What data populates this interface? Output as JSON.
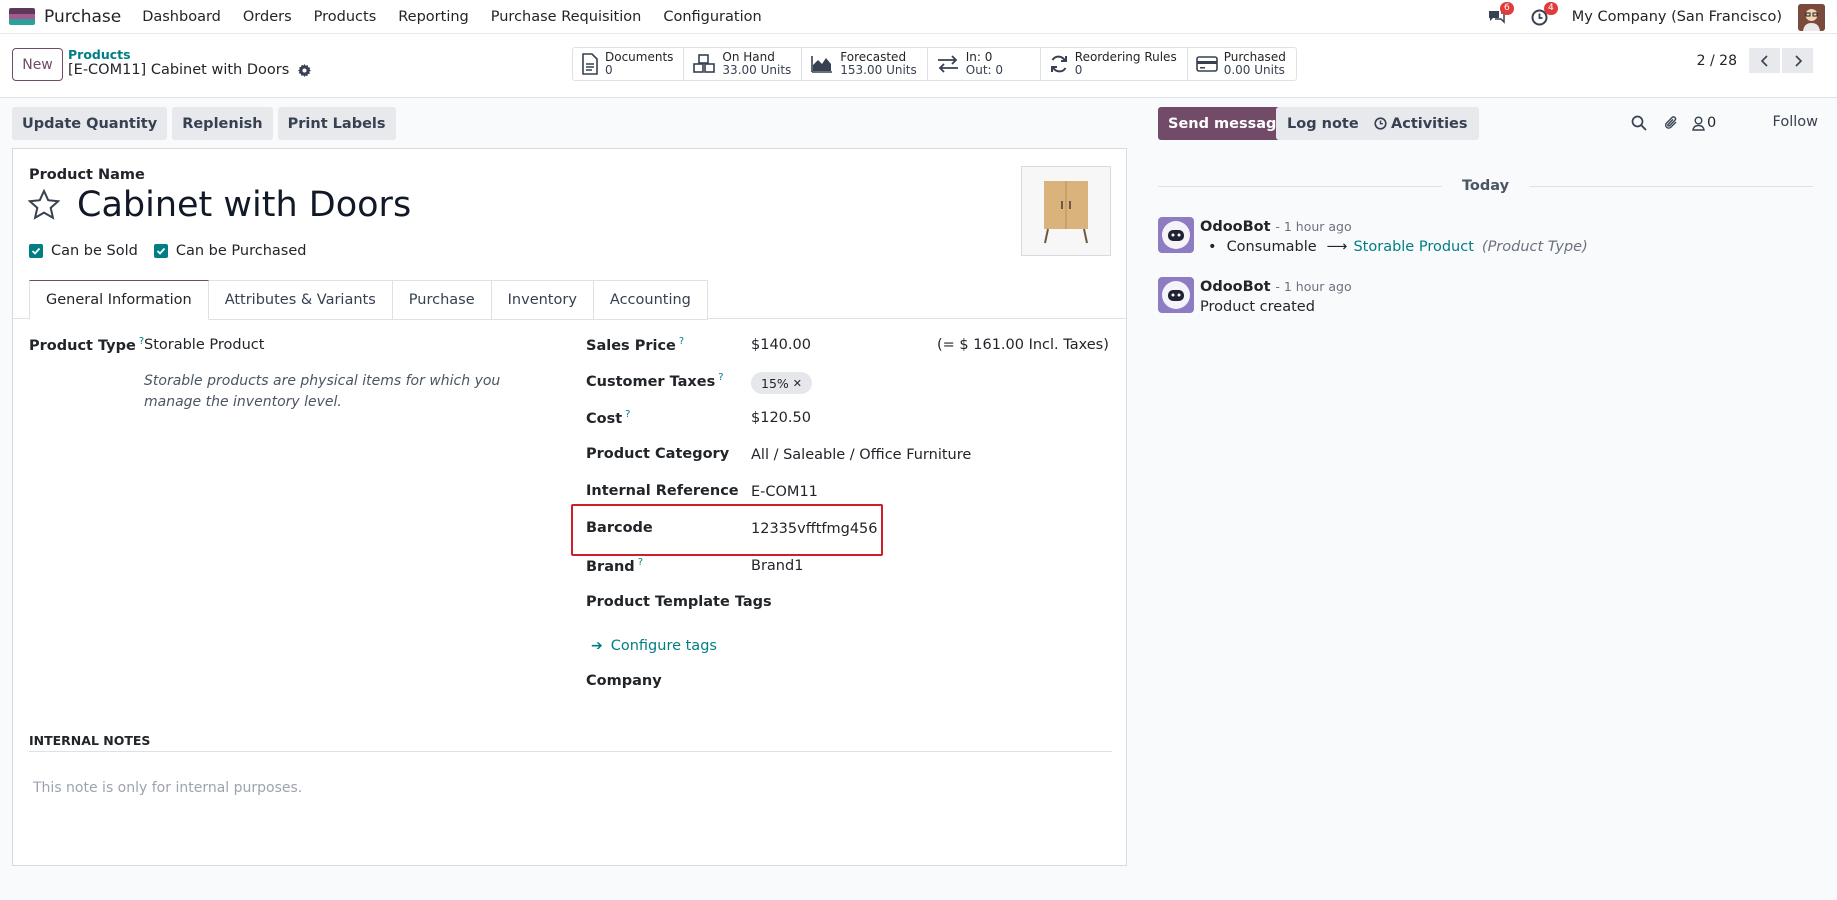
{
  "navbar": {
    "app_name": "Purchase",
    "menu": [
      "Dashboard",
      "Orders",
      "Products",
      "Reporting",
      "Purchase Requisition",
      "Configuration"
    ],
    "messages_count": "6",
    "activities_count": "4",
    "company": "My Company (San Francisco)"
  },
  "control": {
    "new_label": "New",
    "breadcrumb_parent": "Products",
    "breadcrumb_current": "[E-COM11] Cabinet with Doors",
    "smart_buttons": [
      {
        "icon": "document-icon",
        "label": "Documents",
        "value": "0"
      },
      {
        "icon": "cubes-icon",
        "label": "On Hand",
        "value": "33.00 Units"
      },
      {
        "icon": "area-chart-icon",
        "label": "Forecasted",
        "value": "153.00 Units"
      },
      {
        "icon": "exchange-icon",
        "label": "In: 0",
        "value": "Out: 0"
      },
      {
        "icon": "refresh-icon",
        "label": "Reordering Rules",
        "value": "0"
      },
      {
        "icon": "credit-card-icon",
        "label": "Purchased",
        "value": "0.00 Units"
      }
    ],
    "pager": "2 / 28"
  },
  "actions": [
    "Update Quantity",
    "Replenish",
    "Print Labels"
  ],
  "form": {
    "name_label": "Product Name",
    "product_name": "Cabinet with Doors",
    "can_be_sold": "Can be Sold",
    "can_be_purchased": "Can be Purchased",
    "tabs": [
      "General Information",
      "Attributes & Variants",
      "Purchase",
      "Inventory",
      "Accounting"
    ],
    "product_type_label": "Product Type",
    "product_type_value": "Storable Product",
    "product_type_help": "Storable products are physical items for which you manage the inventory level.",
    "sales_price_label": "Sales Price",
    "sales_price_value": "$140.00",
    "sales_price_incl": "(= $ 161.00 Incl. Taxes)",
    "customer_taxes_label": "Customer Taxes",
    "customer_taxes_tag": "15%",
    "cost_label": "Cost",
    "cost_value": "$120.50",
    "category_label": "Product Category",
    "category_value": "All / Saleable / Office Furniture",
    "internal_ref_label": "Internal Reference",
    "internal_ref_value": "E-COM11",
    "barcode_label": "Barcode",
    "barcode_value": "12335vfftfmg456",
    "brand_label": "Brand",
    "brand_value": "Brand1",
    "template_tags_label": "Product Template Tags",
    "configure_tags": "Configure tags",
    "company_label": "Company",
    "help_mark": "?",
    "internal_notes_label": "INTERNAL NOTES",
    "internal_notes_placeholder": "This note is only for internal purposes."
  },
  "chatter": {
    "send_message": "Send message",
    "log_note": "Log note",
    "activities": "Activities",
    "followers_count": "0",
    "follow": "Follow",
    "today": "Today",
    "messages": [
      {
        "author": "OdooBot",
        "time": "- 1 hour ago",
        "old": "Consumable",
        "new": "Storable Product",
        "field": "(Product Type)"
      },
      {
        "author": "OdooBot",
        "time": "- 1 hour ago",
        "body": "Product created"
      }
    ]
  },
  "colors": {
    "brand": "#714b67",
    "accent": "#017e84",
    "highlight": "#cc1f2a"
  }
}
